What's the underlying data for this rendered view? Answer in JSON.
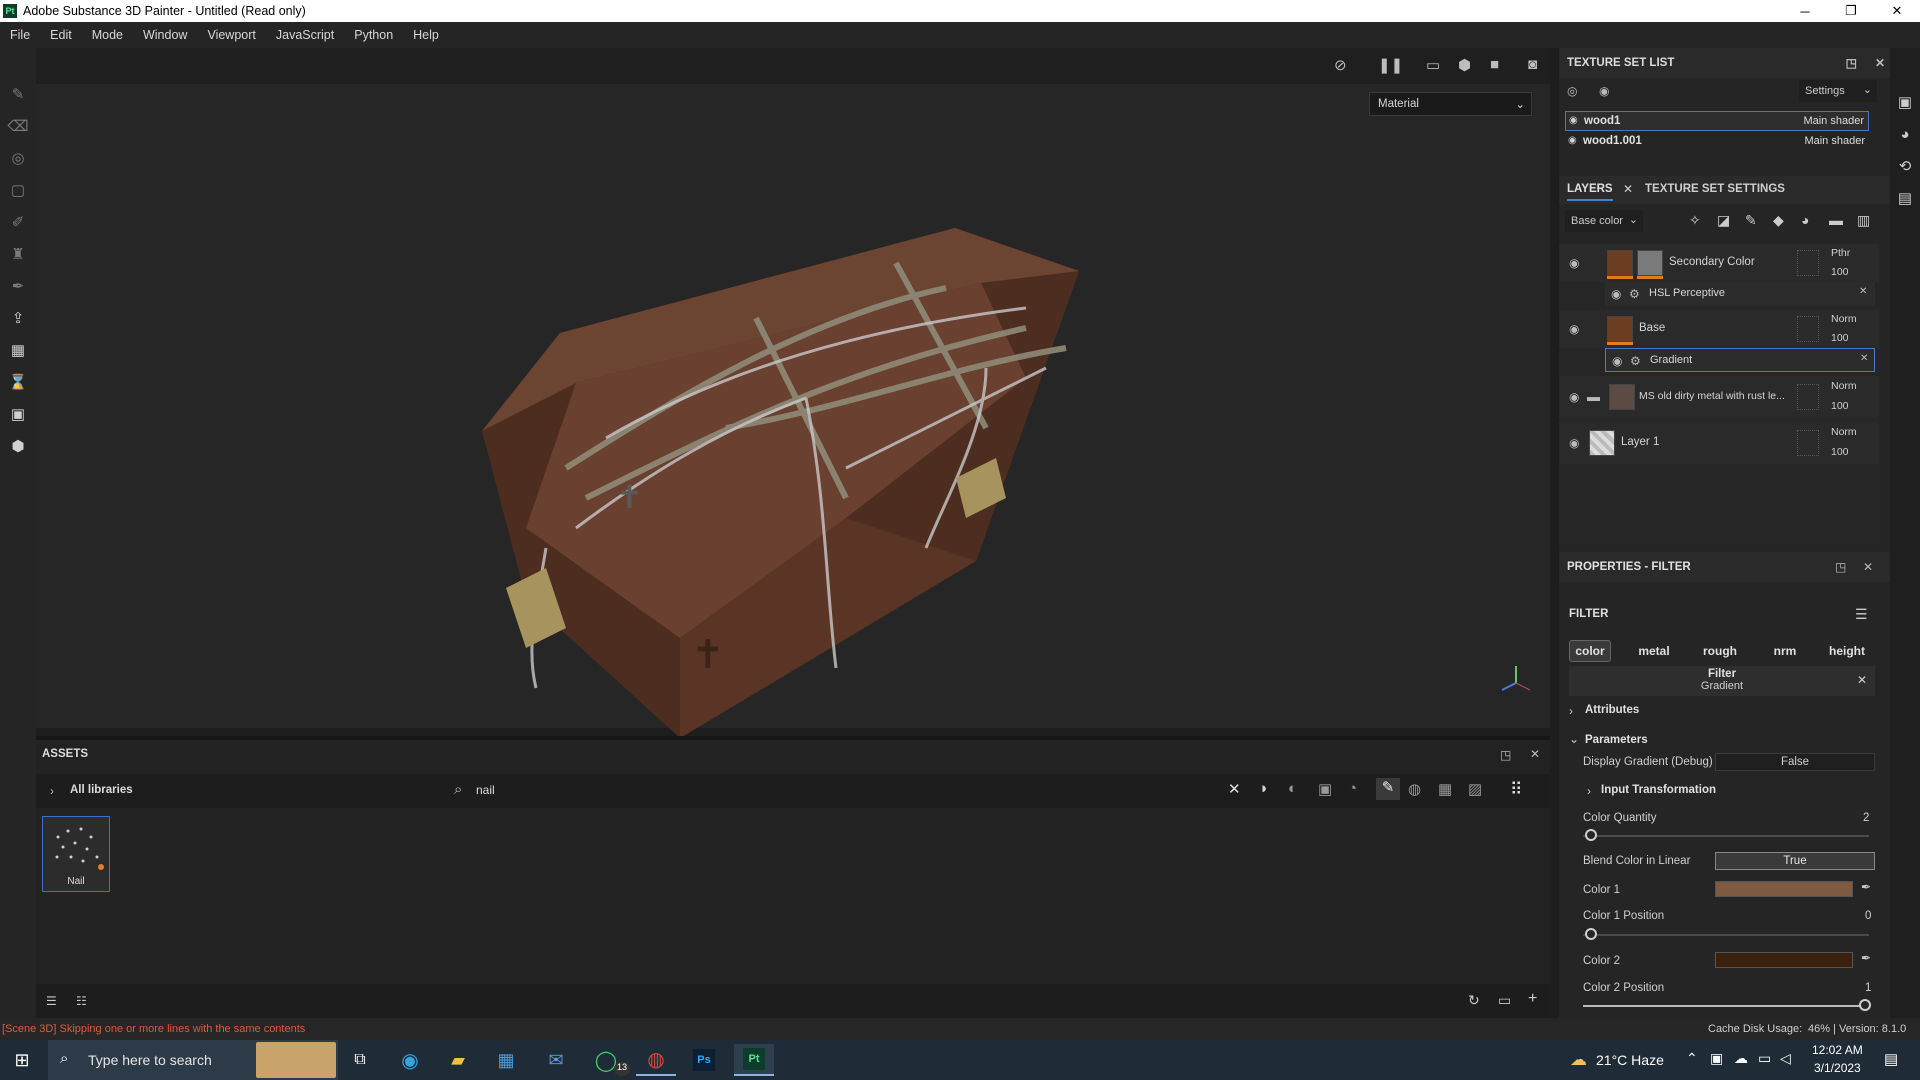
{
  "window": {
    "title": "Adobe Substance 3D Painter - Untitled (Read only)",
    "app_icon": "Pt",
    "minimize": "─",
    "maximize": "❐",
    "close": "✕"
  },
  "menu": [
    "File",
    "Edit",
    "Mode",
    "Window",
    "Viewport",
    "JavaScript",
    "Python",
    "Help"
  ],
  "viewport": {
    "material_select": "Material"
  },
  "assets": {
    "title": "ASSETS",
    "libraries": "All libraries",
    "search_value": "nail",
    "items": [
      {
        "label": "Nail"
      }
    ]
  },
  "texture_set_list": {
    "title": "TEXTURE SET LIST",
    "settings_label": "Settings",
    "items": [
      {
        "name": "wood1",
        "shader": "Main shader"
      },
      {
        "name": "wood1.001",
        "shader": "Main shader"
      }
    ]
  },
  "layers": {
    "tab_layers": "LAYERS",
    "tab_tss": "TEXTURE SET SETTINGS",
    "channel_select": "Base color",
    "items": [
      {
        "name": "Secondary Color",
        "blend": "Pthr",
        "opacity": "100"
      },
      {
        "name": "HSL Perceptive"
      },
      {
        "name": "Base",
        "blend": "Norm",
        "opacity": "100"
      },
      {
        "name": "Gradient"
      },
      {
        "name": "MS old dirty metal with rust le...",
        "blend": "Norm",
        "opacity": "100"
      },
      {
        "name": "Layer 1",
        "blend": "Norm",
        "opacity": "100"
      }
    ]
  },
  "properties": {
    "title": "PROPERTIES - FILTER",
    "section": "FILTER",
    "channels": [
      "color",
      "metal",
      "rough",
      "nrm",
      "height"
    ],
    "filter_label": "Filter",
    "filter_name": "Gradient",
    "attributes": "Attributes",
    "parameters": "Parameters",
    "display_gradient_label": "Display Gradient (Debug)",
    "display_gradient_value": "False",
    "input_transformation": "Input Transformation",
    "color_quantity_label": "Color Quantity",
    "color_quantity_value": "2",
    "color_quantity_fraction": 0.0,
    "blend_linear_label": "Blend Color in Linear",
    "blend_linear_value": "True",
    "color1_label": "Color 1",
    "color1_hex": "#7d5a40",
    "color1_pos_label": "Color 1 Position",
    "color1_pos_value": "0",
    "color2_label": "Color 2",
    "color2_hex": "#3a210d",
    "color2_pos_label": "Color 2 Position",
    "color2_pos_value": "1"
  },
  "status": {
    "message": "[Scene 3D] Skipping one or more lines with the same contents",
    "cache": "Cache Disk Usage:",
    "cache_value": "46% | Version: 8.1.0"
  },
  "taskbar": {
    "search_placeholder": "Type here to search",
    "weather": "21°C  Haze",
    "time": "12:02 AM",
    "date": "3/1/2023",
    "whatsapp_badge": "13",
    "ps_label": "Ps",
    "pt_label": "Pt"
  }
}
